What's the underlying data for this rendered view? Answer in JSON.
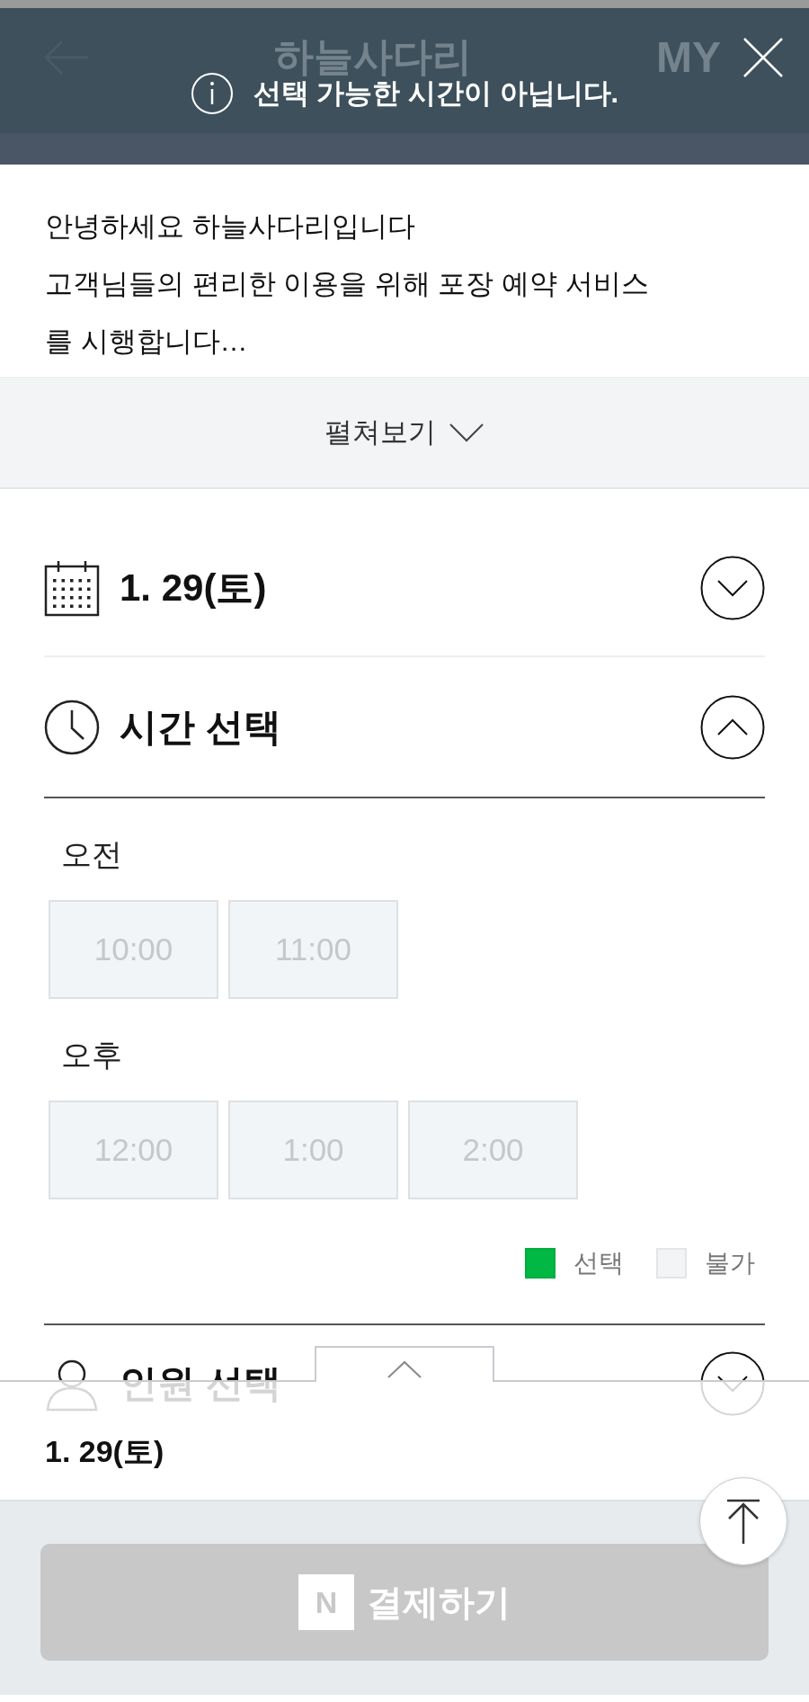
{
  "header": {
    "title": "하늘사다리",
    "action": "MY"
  },
  "toast": {
    "message": "선택 가능한 시간이 아닙니다."
  },
  "intro": {
    "lines": [
      "안녕하세요 하늘사다리입니다",
      "고객님들의 편리한 이용을 위해 포장 예약 서비스",
      "를 시행합니다…"
    ]
  },
  "expand_button": "펼쳐보기",
  "date_section": {
    "label": "1. 29(토)",
    "expanded": false
  },
  "time_section": {
    "label": "시간 선택",
    "expanded": true,
    "groups": [
      {
        "label": "오전",
        "slots": [
          {
            "time": "10:00",
            "available": false,
            "selected": false
          },
          {
            "time": "11:00",
            "available": false,
            "selected": false
          }
        ]
      },
      {
        "label": "오후",
        "slots": [
          {
            "time": "12:00",
            "available": false,
            "selected": false
          },
          {
            "time": "1:00",
            "available": false,
            "selected": false
          },
          {
            "time": "2:00",
            "available": false,
            "selected": false
          }
        ]
      }
    ]
  },
  "legend": [
    {
      "label": "선택",
      "color": "#00b843"
    },
    {
      "label": "불가",
      "color": "#f2f4f5"
    }
  ],
  "people_section": {
    "label": "인원 선택",
    "expanded": false
  },
  "summary": {
    "date": "1. 29(토)"
  },
  "pay_button": {
    "logo": "N",
    "label": "결제하기",
    "disabled": true
  }
}
